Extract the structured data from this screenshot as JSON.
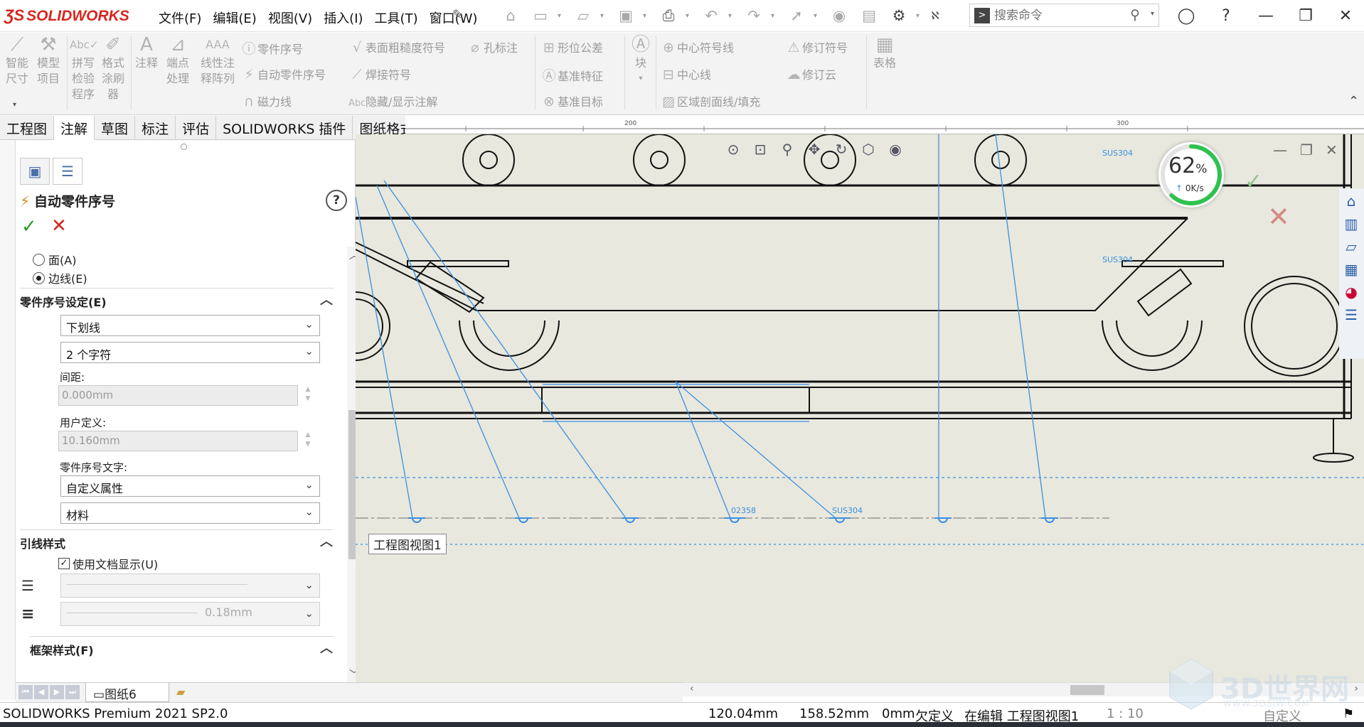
{
  "app": {
    "logo_text": "SOLIDWORKS",
    "logo_prefix": "3S"
  },
  "menu": [
    "文件(F)",
    "编辑(E)",
    "视图(V)",
    "插入(I)",
    "工具(T)",
    "窗口(W)"
  ],
  "search": {
    "placeholder": "搜索命令"
  },
  "ribbon": {
    "smart_dim": "智能\n尺寸",
    "model_items": "模型\n项目",
    "spell_check": "拼写\n检验\n程序",
    "format_painter": "格式\n涂刷\n器",
    "note": "注释",
    "endpoint": "端点\n处理",
    "linear_note": "线性注\n释阵列",
    "balloon": "零件序号",
    "auto_balloon": "自动零件序号",
    "magnetic_line": "磁力线",
    "surface_finish": "表面粗糙度符号",
    "hole_callout": "孔标注",
    "weld_symbol": "焊接符号",
    "hide_show": "隐藏/显示注解",
    "gtol": "形位公差",
    "datum_feature": "基准特征",
    "datum_target": "基准目标",
    "block": "块",
    "center_mark": "中心符号线",
    "centerline": "中心线",
    "area_hatch": "区域剖面线/填充",
    "revision_symbol": "修订符号",
    "revision_cloud": "修订云",
    "table": "表格"
  },
  "tabs": [
    "工程图",
    "注解",
    "草图",
    "标注",
    "评估",
    "SOLIDWORKS 插件",
    "图纸格式"
  ],
  "active_tab": "注解",
  "pm": {
    "title": "自动零件序号",
    "radio_face": "面(A)",
    "radio_edge": "边线(E)",
    "selected_radio": "边线(E)",
    "balloon_settings": "零件序号设定(E)",
    "style_value": "下划线",
    "size_value": "2 个字符",
    "spacing_label": "间距:",
    "spacing_value": "0.000mm",
    "user_defined_label": "用户定义:",
    "user_defined_value": "10.160mm",
    "balloon_text_label": "零件序号文字:",
    "balloon_text_value": "自定义属性",
    "property_value": "材料",
    "leader_style": "引线样式",
    "use_doc_display": "使用文档显示(U)",
    "use_doc_display_checked": true,
    "line_weight": "0.18mm",
    "frame_style": "框架样式(F)"
  },
  "canvas": {
    "view_label": "工程图视图1",
    "balloon_1": "02358",
    "balloon_2": "SUS304",
    "balloon_3": "SUS304",
    "balloon_4": "SUS304",
    "ruler_1": "200",
    "ruler_2": "300"
  },
  "progress": {
    "percent": "62",
    "unit": "%",
    "speed": "0K/s"
  },
  "sheet": {
    "name": "图纸6"
  },
  "status": {
    "product": "SOLIDWORKS Premium 2021 SP2.0",
    "x": "120.04mm",
    "y": "158.52mm",
    "z": "0mm",
    "state": "欠定义",
    "editing": "在编辑 工程图视图1",
    "scale": "1 : 10",
    "units": "自定义"
  },
  "watermark": {
    "text": "3D世界网",
    "sub": "WWW.3DSJW.COM"
  },
  "colors": {
    "accent_red": "#d7261e",
    "selection_blue": "#3b8fe0",
    "ok_green": "#2e9a2e",
    "cancel_red": "#d2241d",
    "progress_green": "#2fc24f"
  }
}
